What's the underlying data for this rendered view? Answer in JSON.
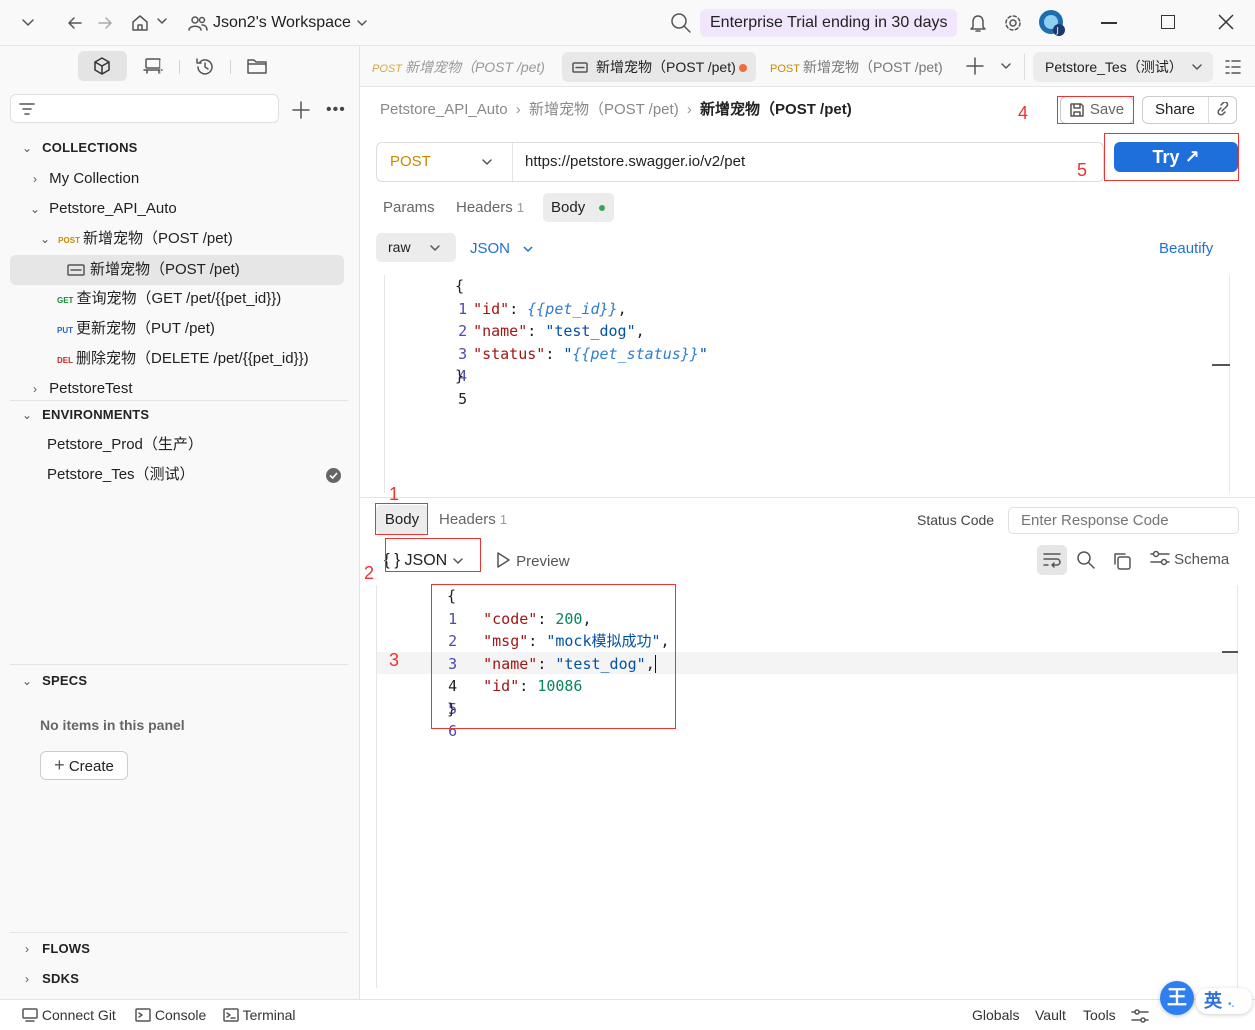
{
  "topbar": {
    "workspace": "Json2's Workspace",
    "trial": "Enterprise Trial ending in 30 days"
  },
  "sidebar": {
    "collections_header": "COLLECTIONS",
    "items": [
      {
        "label": "My Collection"
      },
      {
        "label": "Petstore_API_Auto"
      },
      {
        "method": "POST",
        "label": "新增宠物（POST /pet)"
      },
      {
        "label": "新增宠物（POST /pet)"
      },
      {
        "method": "GET",
        "label": "查询宠物（GET /pet/{{pet_id}})"
      },
      {
        "method": "PUT",
        "label": "更新宠物（PUT /pet)"
      },
      {
        "method": "DEL",
        "label": "删除宠物（DELETE /pet/{{pet_id}})"
      },
      {
        "label": "PetstoreTest"
      }
    ],
    "environments_header": "ENVIRONMENTS",
    "environments": [
      "Petstore_Prod（生产）",
      "Petstore_Tes（测试）"
    ],
    "specs_header": "SPECS",
    "specs_empty": "No items in this panel",
    "create_label": "Create",
    "flows_header": "FLOWS",
    "sdks_header": "SDKS"
  },
  "tabs": [
    {
      "method": "POST",
      "label": "新增宠物（POST /pet)"
    },
    {
      "label": "新增宠物（POST /pet)"
    },
    {
      "method": "POST",
      "label": "新增宠物（POST /pet)"
    }
  ],
  "env_selector": "Petstore_Tes（测试）",
  "breadcrumb": {
    "collection": "Petstore_API_Auto",
    "parent": "新增宠物（POST /pet)",
    "current": "新增宠物（POST /pet)"
  },
  "actions": {
    "save": "Save",
    "share": "Share",
    "try": "Try ↗"
  },
  "request": {
    "method": "POST",
    "url": "https://petstore.swagger.io/v2/pet",
    "tabs": {
      "params": "Params",
      "headers": "Headers",
      "headers_count": "1",
      "body": "Body"
    },
    "body_mode": "raw",
    "body_format": "JSON",
    "beautify": "Beautify",
    "line_numbers": [
      "1",
      "2",
      "3",
      "4",
      "5"
    ]
  },
  "response": {
    "tabs": {
      "body": "Body",
      "headers": "Headers",
      "headers_count": "1"
    },
    "status_code_label": "Status Code",
    "status_code_placeholder": "Enter Response Code",
    "format": "JSON",
    "preview": "Preview",
    "schema": "Schema",
    "line_numbers": [
      "1",
      "2",
      "3",
      "4",
      "5",
      "6"
    ]
  },
  "annotations": [
    "1",
    "2",
    "3",
    "4",
    "5"
  ],
  "statusbar": {
    "connect_git": "Connect Git",
    "console": "Console",
    "terminal": "Terminal",
    "globals": "Globals",
    "vault": "Vault",
    "tools": "Tools"
  },
  "ime": {
    "wang": "王",
    "ying": "英"
  },
  "colors": {
    "accent": "#1e6fdb",
    "post": "#c78a00",
    "get": "#178a3a",
    "put": "#2a62c9",
    "del": "#c62828",
    "annotation": "#e33333"
  }
}
